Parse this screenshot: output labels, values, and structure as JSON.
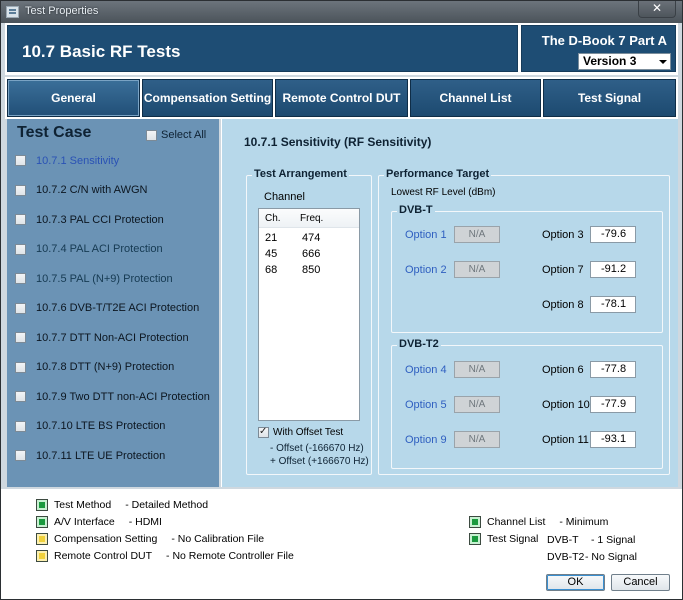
{
  "window": {
    "title": "Test Properties",
    "close_label": "✕"
  },
  "header": {
    "title": "10.7 Basic RF Tests",
    "subtitle": "The D-Book 7 Part A",
    "version": "Version 3"
  },
  "tabs": [
    {
      "label": "General"
    },
    {
      "label": "Compensation Setting"
    },
    {
      "label": "Remote Control DUT"
    },
    {
      "label": "Channel List"
    },
    {
      "label": "Test Signal"
    }
  ],
  "left": {
    "title": "Test Case",
    "select_all": "Select All",
    "items": [
      {
        "label": "10.7.1 Sensitivity"
      },
      {
        "label": "10.7.2 C/N with AWGN"
      },
      {
        "label": "10.7.3 PAL CCI Protection"
      },
      {
        "label": "10.7.4 PAL ACI Protection"
      },
      {
        "label": "10.7.5 PAL (N+9) Protection"
      },
      {
        "label": "10.7.6 DVB-T/T2E ACI Protection"
      },
      {
        "label": "10.7.7 DTT Non-ACI Protection"
      },
      {
        "label": "10.7.8 DTT (N+9) Protection"
      },
      {
        "label": "10.7.9 Two DTT non-ACI Protection"
      },
      {
        "label": "10.7.10 LTE BS Protection"
      },
      {
        "label": "10.7.11 LTE UE Protection"
      }
    ]
  },
  "right": {
    "title": "10.7.1 Sensitivity (RF Sensitivity)",
    "arrangement": {
      "label": "Test Arrangement",
      "channel_label": "Channel",
      "col_ch": "Ch.",
      "col_freq": "Freq.",
      "rows": [
        {
          "ch": "21",
          "freq": "474"
        },
        {
          "ch": "45",
          "freq": "666"
        },
        {
          "ch": "68",
          "freq": "850"
        }
      ],
      "offset_label": "With Offset Test",
      "offset_minus": "- Offset (-166670 Hz)",
      "offset_plus": "+ Offset (+166670 Hz)"
    },
    "performance": {
      "label": "Performance Target",
      "lowest_label": "Lowest RF Level (dBm)",
      "dvbt": {
        "label": "DVB-T",
        "opt1": "Option 1",
        "opt1_val": "N/A",
        "opt2": "Option 2",
        "opt2_val": "N/A",
        "opt3": "Option 3",
        "opt3_val": "-79.6",
        "opt7": "Option 7",
        "opt7_val": "-91.2",
        "opt8": "Option 8",
        "opt8_val": "-78.1"
      },
      "dvbt2": {
        "label": "DVB-T2",
        "opt4": "Option 4",
        "opt4_val": "N/A",
        "opt5": "Option 5",
        "opt5_val": "N/A",
        "opt9": "Option 9",
        "opt9_val": "N/A",
        "opt6": "Option 6",
        "opt6_val": "-77.8",
        "opt10": "Option 10",
        "opt10_val": "-77.9",
        "opt11": "Option 11",
        "opt11_val": "-93.1"
      }
    }
  },
  "status": {
    "test_method": {
      "key": "Test Method",
      "value": "- Detailed Method",
      "color": "#1a9a3e"
    },
    "av_interface": {
      "key": "A/V Interface",
      "value": "- HDMI",
      "color": "#1a9a3e"
    },
    "compensation": {
      "key": "Compensation Setting",
      "value": "- No Calibration File",
      "color": "#f0d13c"
    },
    "remote": {
      "key": "Remote Control DUT",
      "value": "- No Remote Controller File",
      "color": "#f0d13c"
    },
    "channel_list": {
      "key": "Channel List",
      "value": "- Minimum",
      "color": "#1a9a3e"
    },
    "test_signal": {
      "key": "Test Signal",
      "dvbt": "DVB-T",
      "dvbt_val": "- 1 Signal",
      "dvbt2": "DVB-T2",
      "dvbt2_val": "- No Signal",
      "color": "#1a9a3e"
    }
  },
  "buttons": {
    "ok": "OK",
    "cancel": "Cancel"
  }
}
